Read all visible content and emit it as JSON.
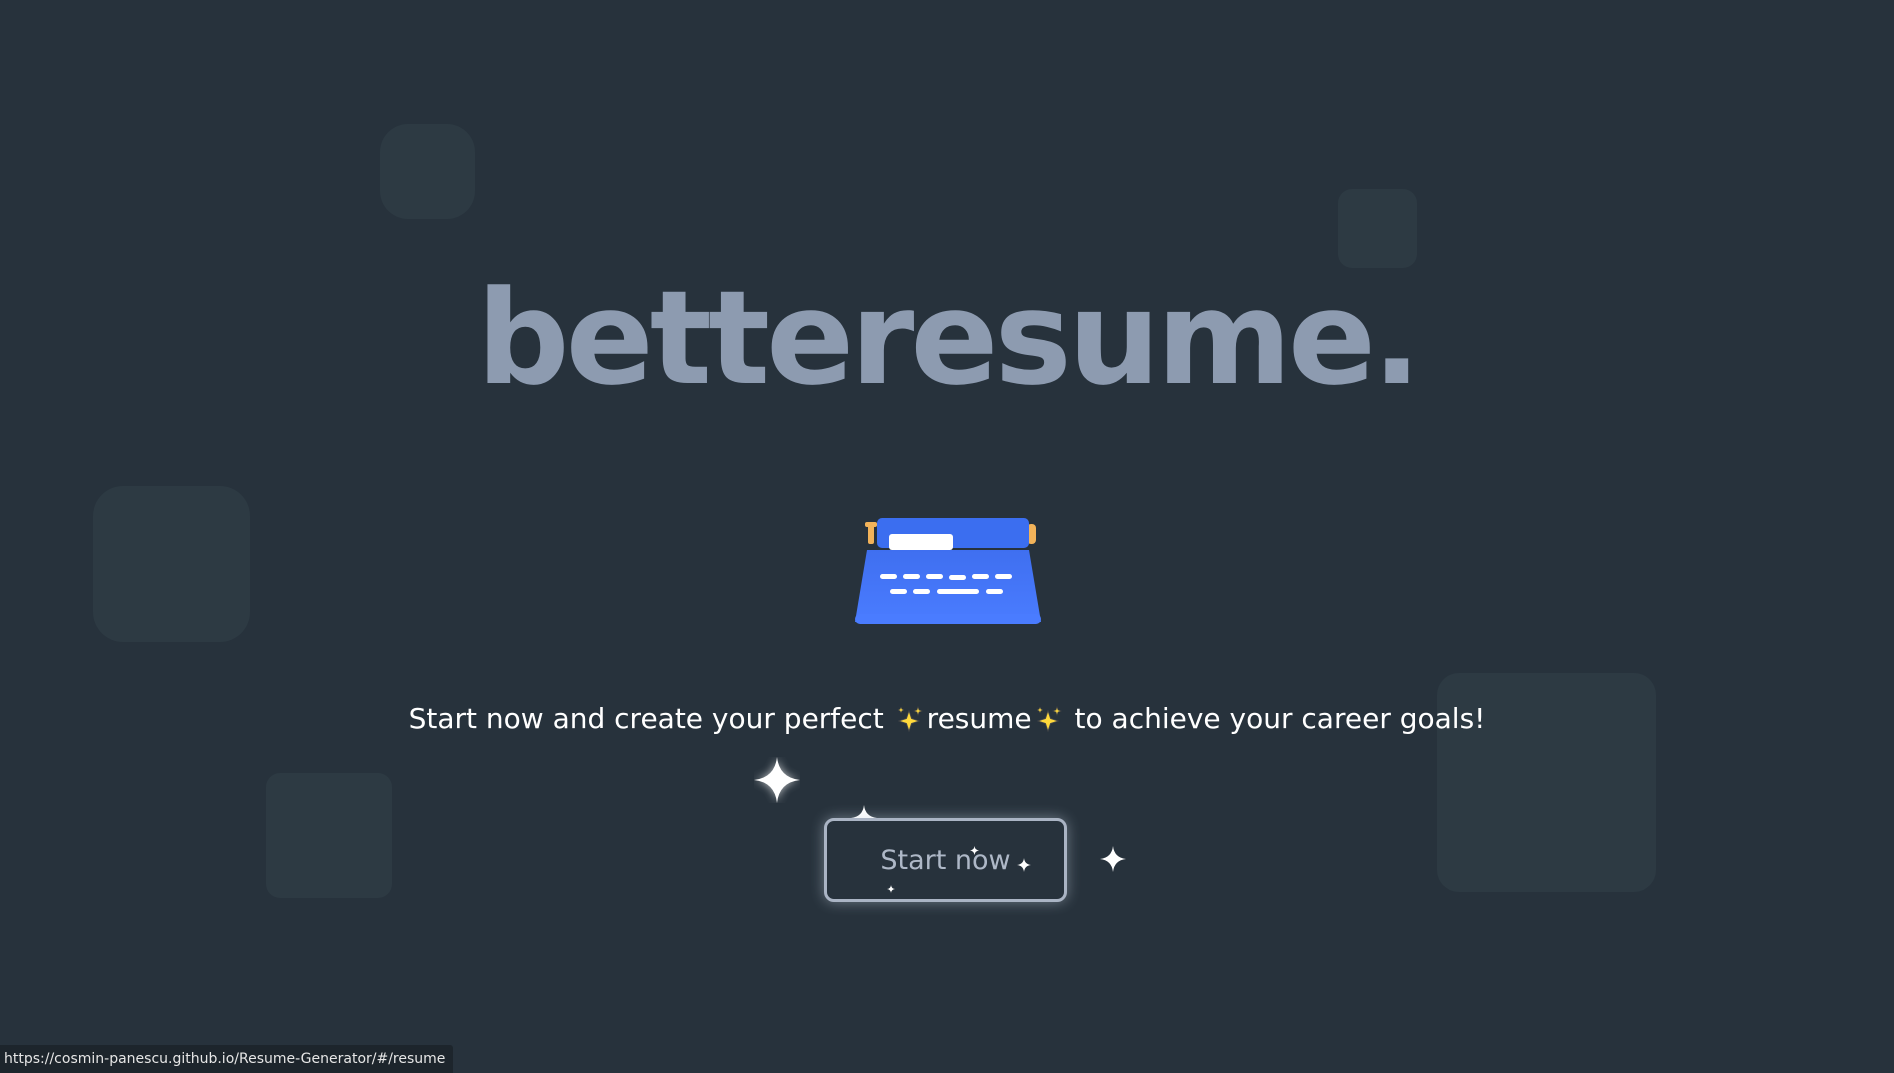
{
  "brand": {
    "title": "betteresume."
  },
  "hero": {
    "tagline_before": "Start now and create your perfect ",
    "tagline_middle": "resume",
    "tagline_after": " to achieve your career goals!",
    "illustration_icon": "typewriter-icon",
    "inline_icon": "sparkles-icon"
  },
  "cta": {
    "label": "Start now"
  },
  "status_bar": {
    "url": "https://cosmin-panescu.github.io/Resume-Generator/#/resume"
  },
  "colors": {
    "background": "#27323c",
    "brand_text": "#8d9bb0",
    "accent_blue": "#3d6ef5",
    "sparkle_yellow": "#ffd93b"
  }
}
